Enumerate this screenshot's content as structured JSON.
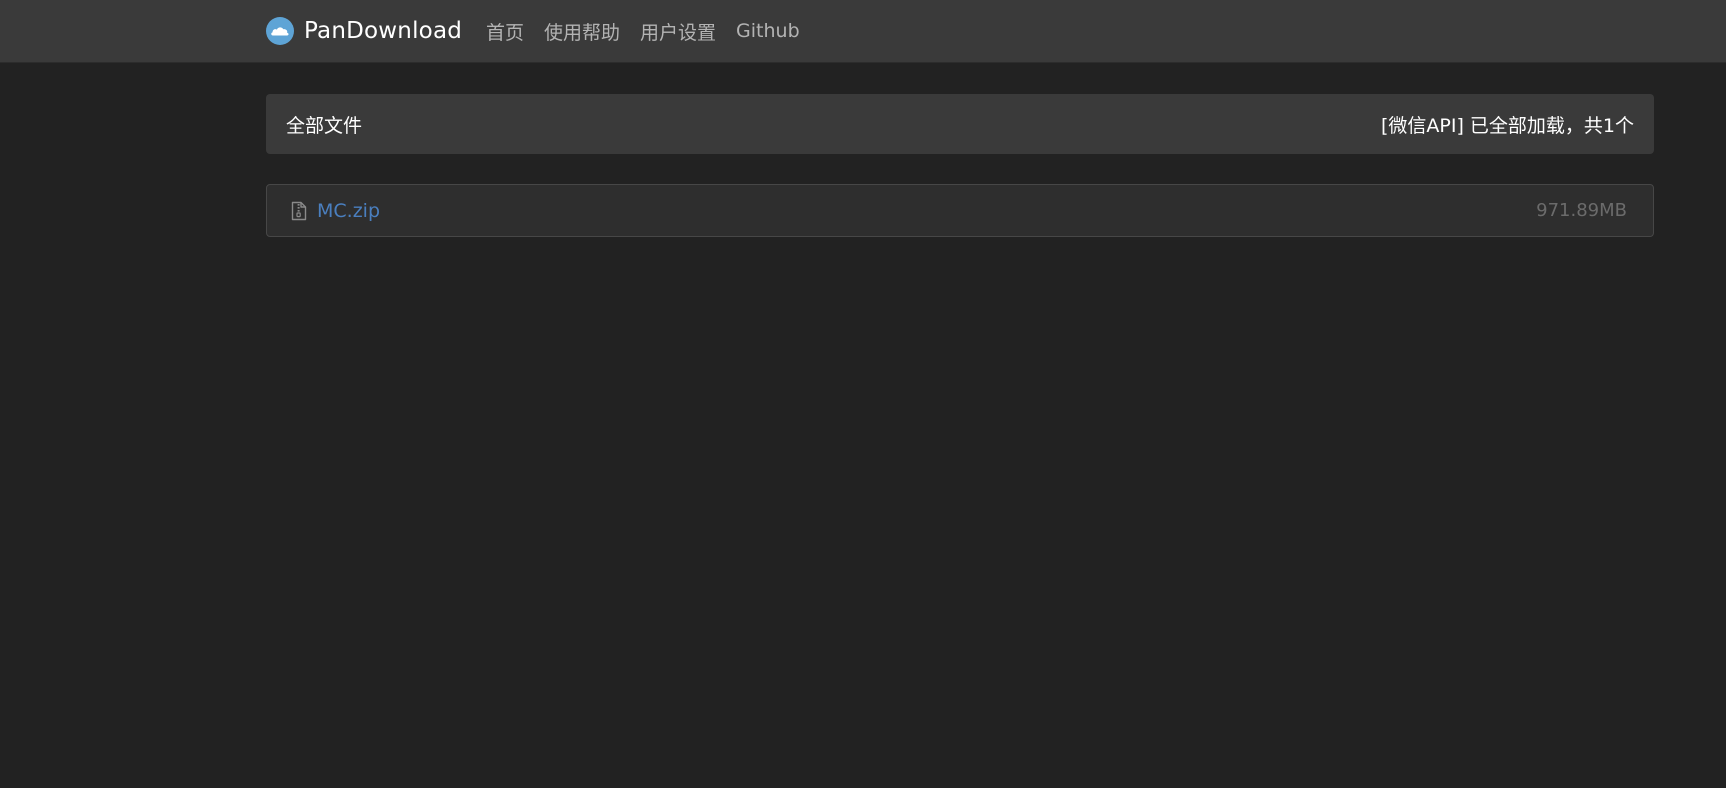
{
  "navbar": {
    "brand_name": "PanDownload",
    "links": [
      {
        "label": "首页"
      },
      {
        "label": "使用帮助"
      },
      {
        "label": "用户设置"
      },
      {
        "label": "Github"
      }
    ]
  },
  "panel": {
    "title": "全部文件",
    "status": "[微信API] 已全部加载，共1个"
  },
  "files": [
    {
      "name": "MC.zip",
      "size": "971.89MB",
      "icon": "zip-file-icon"
    }
  ],
  "colors": {
    "background": "#222222",
    "navbar": "#3a3a3a",
    "link": "#4a7fbf",
    "logo": "#5ea4d6"
  }
}
